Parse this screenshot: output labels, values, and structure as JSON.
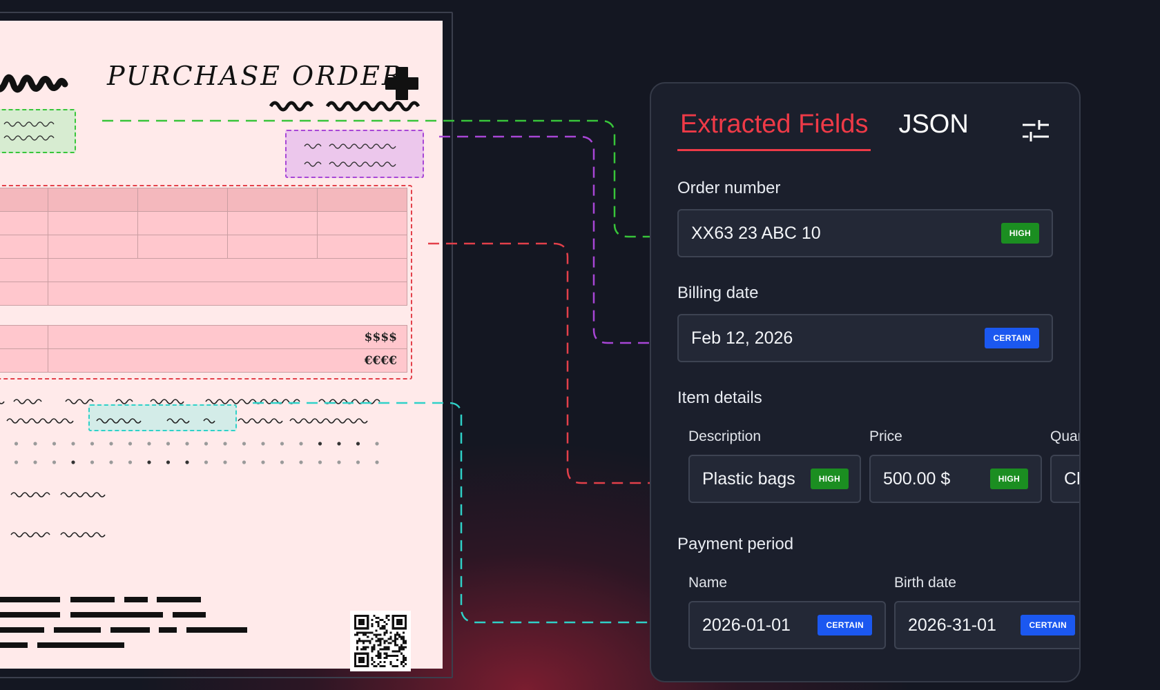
{
  "document": {
    "title": "PURCHASE ORDER",
    "totals": [
      "$$$$",
      "€€€€"
    ]
  },
  "panel": {
    "tabs": [
      {
        "label": "Extracted Fields",
        "active": true
      },
      {
        "label": "JSON",
        "active": false
      }
    ],
    "filter_icon": "sliders-icon",
    "fields": {
      "order_number": {
        "label": "Order number",
        "value": "XX63 23 ABC 10",
        "confidence": "HIGH"
      },
      "billing_date": {
        "label": "Billing date",
        "value": "Feb 12, 2026",
        "confidence": "CERTAIN"
      },
      "item_details": {
        "label": "Item details",
        "columns": [
          {
            "label": "Description",
            "value": "Plastic bags",
            "confidence": "HIGH"
          },
          {
            "label": "Price",
            "value": "500.00 $",
            "confidence": "HIGH"
          },
          {
            "label": "Quar",
            "value": "Ch"
          }
        ]
      },
      "payment_period": {
        "label": "Payment period",
        "columns": [
          {
            "label": "Name",
            "value": "2026-01-01",
            "confidence": "CERTAIN"
          },
          {
            "label": "Birth date",
            "value": "2026-31-01",
            "confidence": "CERTAIN"
          }
        ]
      }
    }
  },
  "colors": {
    "accent_red": "#ee3a47",
    "high_badge": "#1b8e21",
    "certain_badge": "#1b58f0",
    "connector_green": "#38c53a",
    "connector_purple": "#a846d6",
    "connector_red": "#e3404a",
    "connector_cyan": "#2fd1c8"
  }
}
